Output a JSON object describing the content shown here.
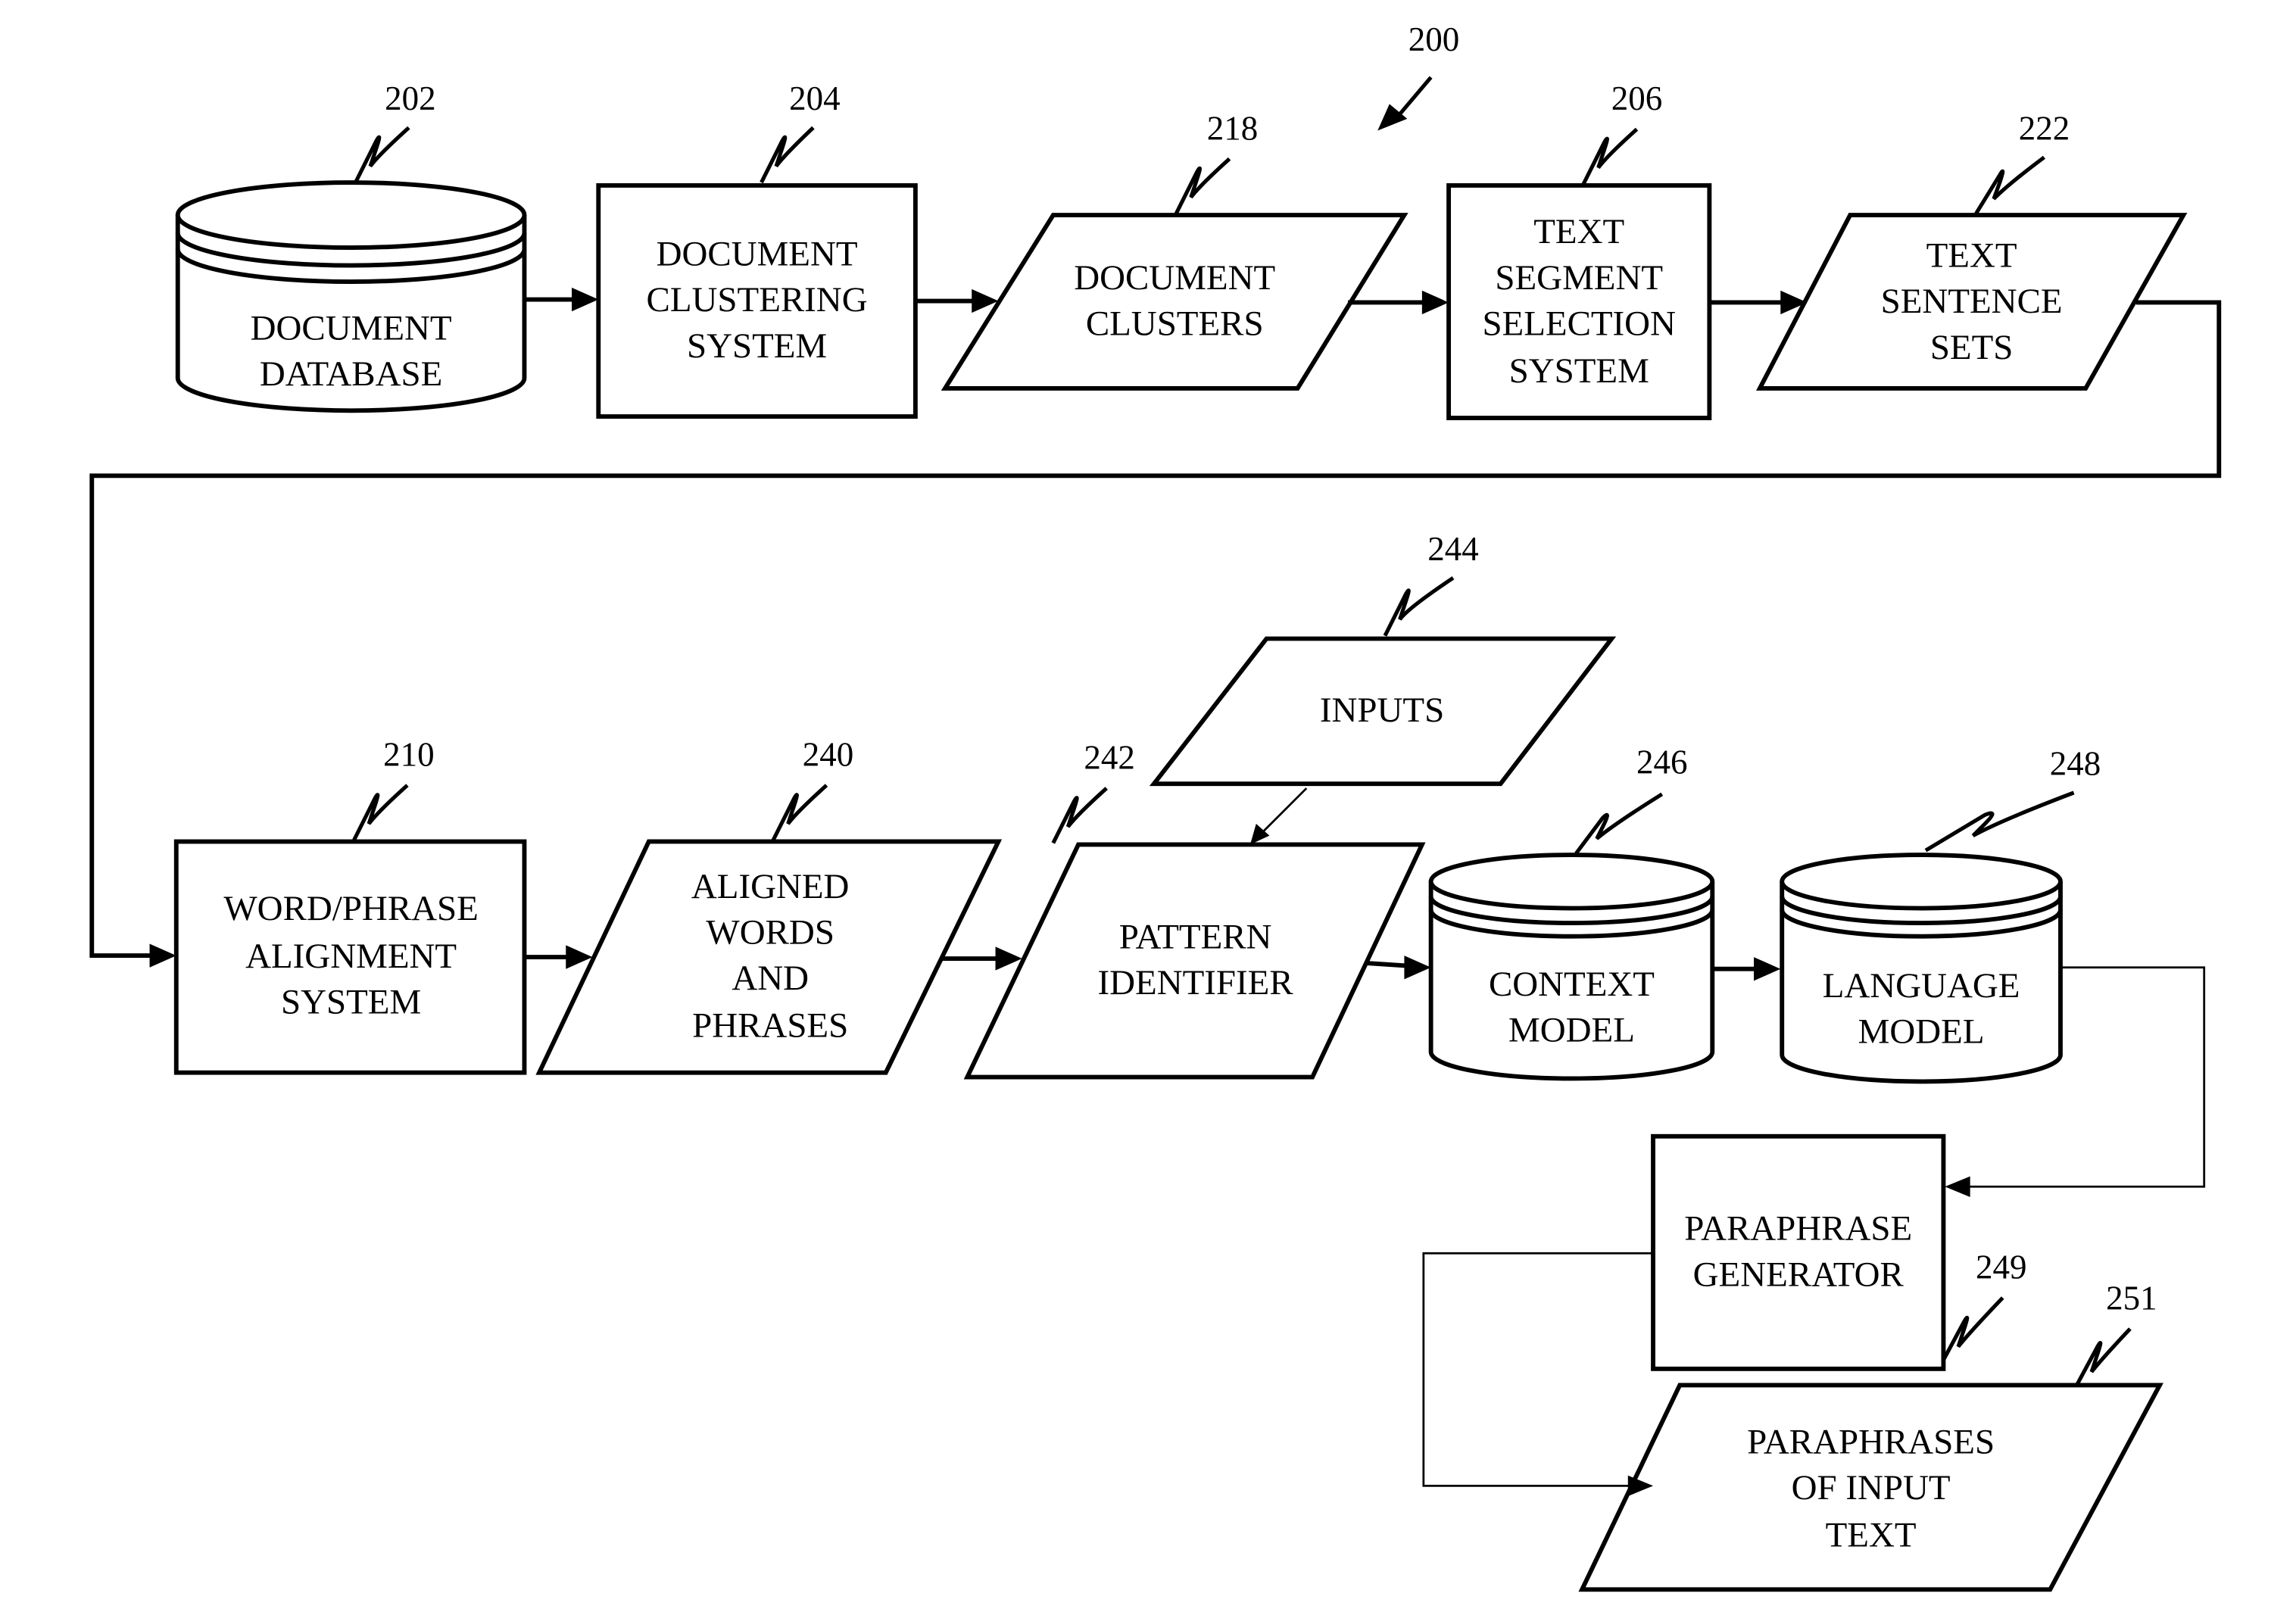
{
  "figure": {
    "reference": "200",
    "nodes": [
      {
        "id": "202",
        "shape": "cylinder",
        "lines": [
          "DOCUMENT",
          "DATABASE"
        ]
      },
      {
        "id": "204",
        "shape": "box",
        "lines": [
          "DOCUMENT",
          "CLUSTERING",
          "SYSTEM"
        ]
      },
      {
        "id": "218",
        "shape": "parallelogram",
        "lines": [
          "DOCUMENT",
          "CLUSTERS"
        ]
      },
      {
        "id": "206",
        "shape": "box",
        "lines": [
          "TEXT",
          "SEGMENT",
          "SELECTION",
          "SYSTEM"
        ]
      },
      {
        "id": "222",
        "shape": "parallelogram",
        "lines": [
          "TEXT",
          "SENTENCE",
          "SETS"
        ]
      },
      {
        "id": "210",
        "shape": "box",
        "lines": [
          "WORD/PHRASE",
          "ALIGNMENT",
          "SYSTEM"
        ]
      },
      {
        "id": "240",
        "shape": "parallelogram",
        "lines": [
          "ALIGNED",
          "WORDS",
          "AND",
          "PHRASES"
        ]
      },
      {
        "id": "242",
        "shape": "parallelogram",
        "lines": [
          "PATTERN",
          "IDENTIFIER"
        ]
      },
      {
        "id": "244",
        "shape": "parallelogram",
        "lines": [
          "INPUTS"
        ]
      },
      {
        "id": "246",
        "shape": "cylinder",
        "lines": [
          "CONTEXT",
          "MODEL"
        ]
      },
      {
        "id": "248",
        "shape": "cylinder",
        "lines": [
          "LANGUAGE",
          "MODEL"
        ]
      },
      {
        "id": "249",
        "shape": "box",
        "lines": [
          "PARAPHRASE",
          "GENERATOR"
        ]
      },
      {
        "id": "251",
        "shape": "parallelogram",
        "lines": [
          "PARAPHRASES",
          "OF INPUT",
          "TEXT"
        ]
      }
    ],
    "edges": [
      {
        "from": "202",
        "to": "204"
      },
      {
        "from": "204",
        "to": "218"
      },
      {
        "from": "218",
        "to": "206"
      },
      {
        "from": "206",
        "to": "222"
      },
      {
        "from": "222",
        "to": "210"
      },
      {
        "from": "210",
        "to": "240"
      },
      {
        "from": "240",
        "to": "242"
      },
      {
        "from": "244",
        "to": "242"
      },
      {
        "from": "242",
        "to": "246"
      },
      {
        "from": "246",
        "to": "248"
      },
      {
        "from": "248",
        "to": "249"
      },
      {
        "from": "249",
        "to": "251"
      }
    ]
  }
}
